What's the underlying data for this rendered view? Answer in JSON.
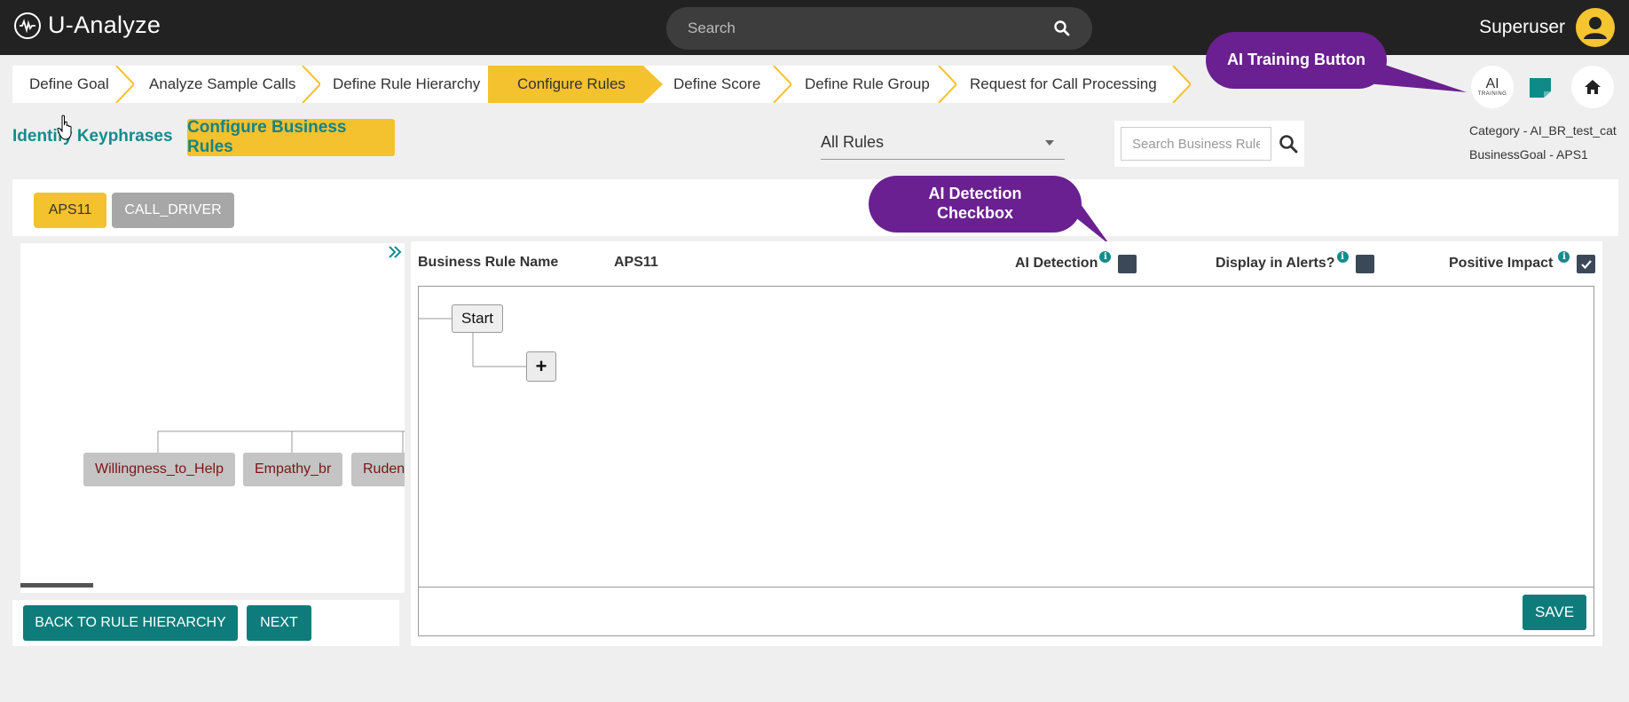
{
  "app": {
    "title": "U-Analyze"
  },
  "search": {
    "placeholder": "Search"
  },
  "user": {
    "name": "Superuser"
  },
  "steps": [
    {
      "label": "Define Goal",
      "active": false
    },
    {
      "label": "Analyze Sample Calls",
      "active": false
    },
    {
      "label": "Define Rule Hierarchy",
      "active": false
    },
    {
      "label": "Configure Rules",
      "active": true
    },
    {
      "label": "Define Score",
      "active": false
    },
    {
      "label": "Define Rule Group",
      "active": false
    },
    {
      "label": "Request for Call Processing",
      "active": false
    }
  ],
  "callouts": {
    "ai_training": "AI Training Button",
    "ai_detection_line1": "AI Detection",
    "ai_detection_line2": "Checkbox"
  },
  "ai_button": {
    "big": "AI",
    "small": "TRAINING"
  },
  "subnav": {
    "identify_link": "Identify Keyphrases",
    "configure_button": "Configure Business Rules"
  },
  "filter": {
    "selected": "All Rules"
  },
  "br_search": {
    "placeholder": "Search Business Rules"
  },
  "info": {
    "category": "Category - AI_BR_test_cat",
    "business_goal": "BusinessGoal - APS1"
  },
  "tags": [
    "APS11",
    "CALL_DRIVER"
  ],
  "hierarchy": {
    "leaves": [
      "Willingness_to_Help",
      "Empathy_br",
      "Rudene"
    ]
  },
  "left_buttons": {
    "back": "BACK TO RULE HIERARCHY",
    "next": "NEXT"
  },
  "rule": {
    "name_label": "Business Rule Name",
    "name_value": "APS11",
    "ai_detection_label": "AI Detection",
    "ai_detection_checked": false,
    "alerts_label": "Display in Alerts?",
    "alerts_checked": false,
    "positive_label": "Positive Impact",
    "positive_checked": true
  },
  "canvas": {
    "start_label": "Start",
    "add_label": "+"
  },
  "save_label": "SAVE",
  "colors": {
    "topbar": "#222222",
    "accent_yellow": "#f4c12f",
    "teal": "#0e7c7b",
    "callout": "#6a2090",
    "leaf_text": "#7a1616"
  }
}
